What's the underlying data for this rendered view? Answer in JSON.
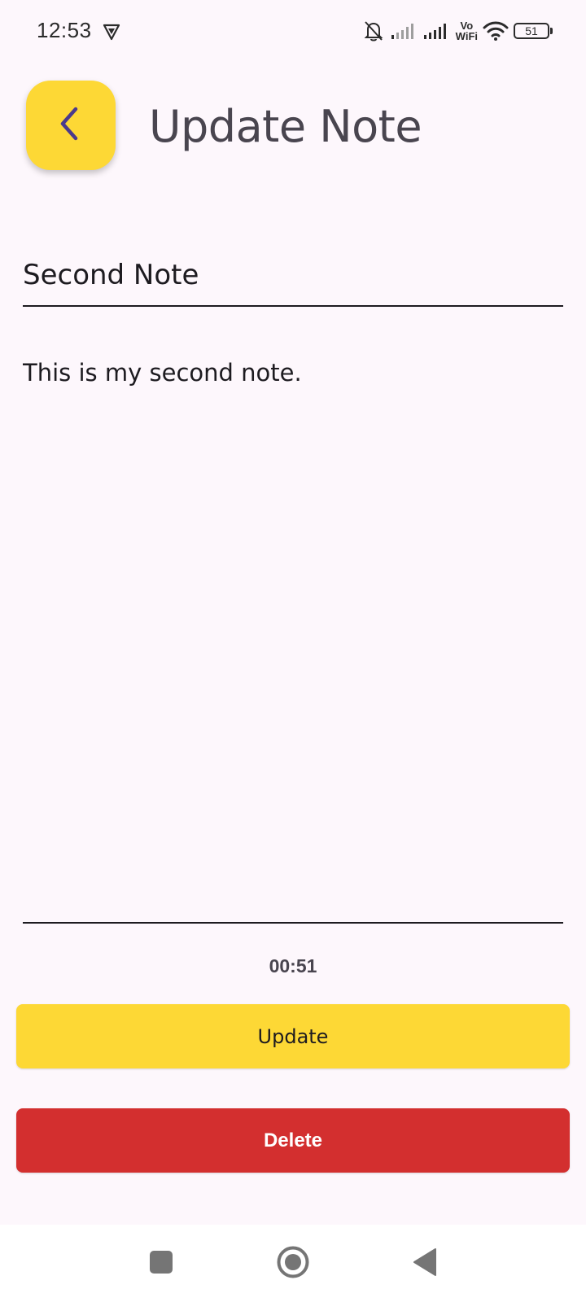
{
  "status_bar": {
    "time": "12:53",
    "vowifi_top": "Vo",
    "vowifi_bottom": "WiFi",
    "battery": "51",
    "icons": [
      "vpn-shield-icon",
      "bell-off-icon",
      "signal-icon",
      "signal-icon",
      "vowifi-icon",
      "wifi-icon",
      "battery-icon"
    ]
  },
  "header": {
    "title": "Update Note",
    "back_icon": "chevron-left-icon"
  },
  "form": {
    "title_value": "Second Note",
    "content_value": "This is my second note."
  },
  "timer": "00:51",
  "actions": {
    "update_label": "Update",
    "delete_label": "Delete"
  },
  "colors": {
    "background": "#FDF7FC",
    "accent_yellow": "#FDD835",
    "delete_red": "#D32F2F",
    "icon_purple": "#4A3A8C",
    "title_gray": "#49454F"
  },
  "nav_bar": {
    "icons": [
      "recents-square-icon",
      "home-circle-icon",
      "back-triangle-icon"
    ]
  }
}
